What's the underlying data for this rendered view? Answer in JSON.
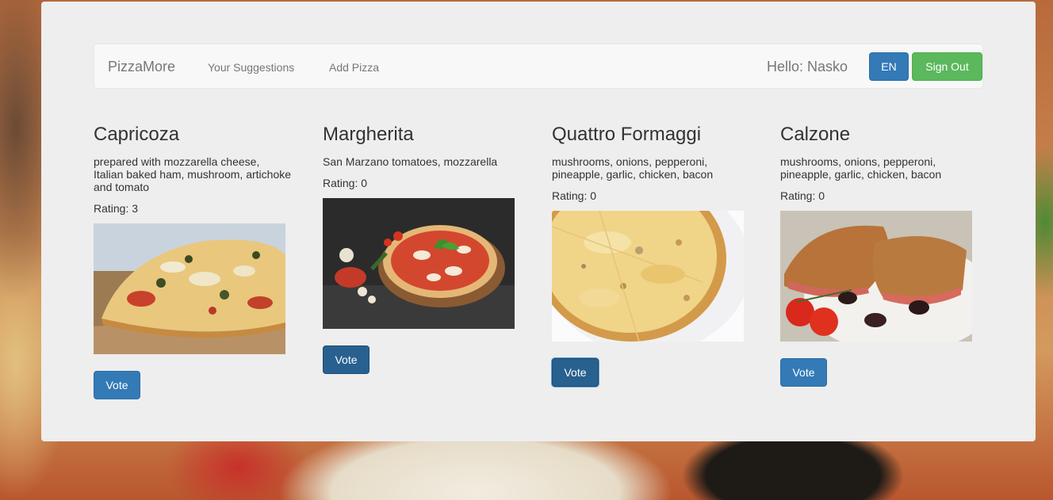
{
  "navbar": {
    "brand": "PizzaMore",
    "links": [
      "Your Suggestions",
      "Add Pizza"
    ],
    "greeting": "Hello: Nasko",
    "lang_button": "EN",
    "signout_button": "Sign Out"
  },
  "pizzas": [
    {
      "name": "Capricoza",
      "description": "prepared with mozzarella cheese, Italian baked ham, mushroom, artichoke and tomato",
      "rating": "Rating: 3",
      "vote_label": "Vote"
    },
    {
      "name": "Margherita",
      "description": "San Marzano tomatoes, mozzarella",
      "rating": "Rating: 0",
      "vote_label": "Vote"
    },
    {
      "name": "Quattro Formaggi",
      "description": "mushrooms, onions, pepperoni, pineapple, garlic, chicken, bacon",
      "rating": "Rating: 0",
      "vote_label": "Vote"
    },
    {
      "name": "Calzone",
      "description": "mushrooms, onions, pepperoni, pineapple, garlic, chicken, bacon",
      "rating": "Rating: 0",
      "vote_label": "Vote"
    }
  ],
  "colors": {
    "primary": "#337ab7",
    "success": "#5cb85c",
    "panel": "#eeeeee"
  }
}
